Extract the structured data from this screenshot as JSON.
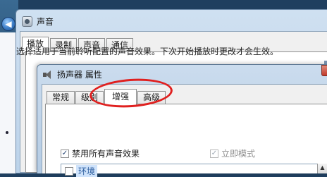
{
  "sound_dialog": {
    "title": "声音",
    "tabs": [
      "播放",
      "录制",
      "声音",
      "通信"
    ],
    "active_tab": 0
  },
  "props_dialog": {
    "title": "扬声器 属性",
    "tabs": [
      "常规",
      "级别",
      "增强",
      "高级"
    ],
    "active_tab": 2,
    "description": "选择适用于当前聆听配置的声音效果。下次开始播放时更改才会生效。",
    "disable_all_label": "禁用所有声音效果",
    "disable_all_checked": true,
    "immediate_mode_label": "立即模式",
    "immediate_mode_checked": true,
    "list_item_label": "环境"
  },
  "colors": {
    "annotation_ring": "#e0201f",
    "title_bar": "#cbdcee"
  },
  "icons": {
    "back": "back-arrow-icon",
    "sound_window": "sound-app-icon",
    "speaker": "speaker-icon"
  }
}
